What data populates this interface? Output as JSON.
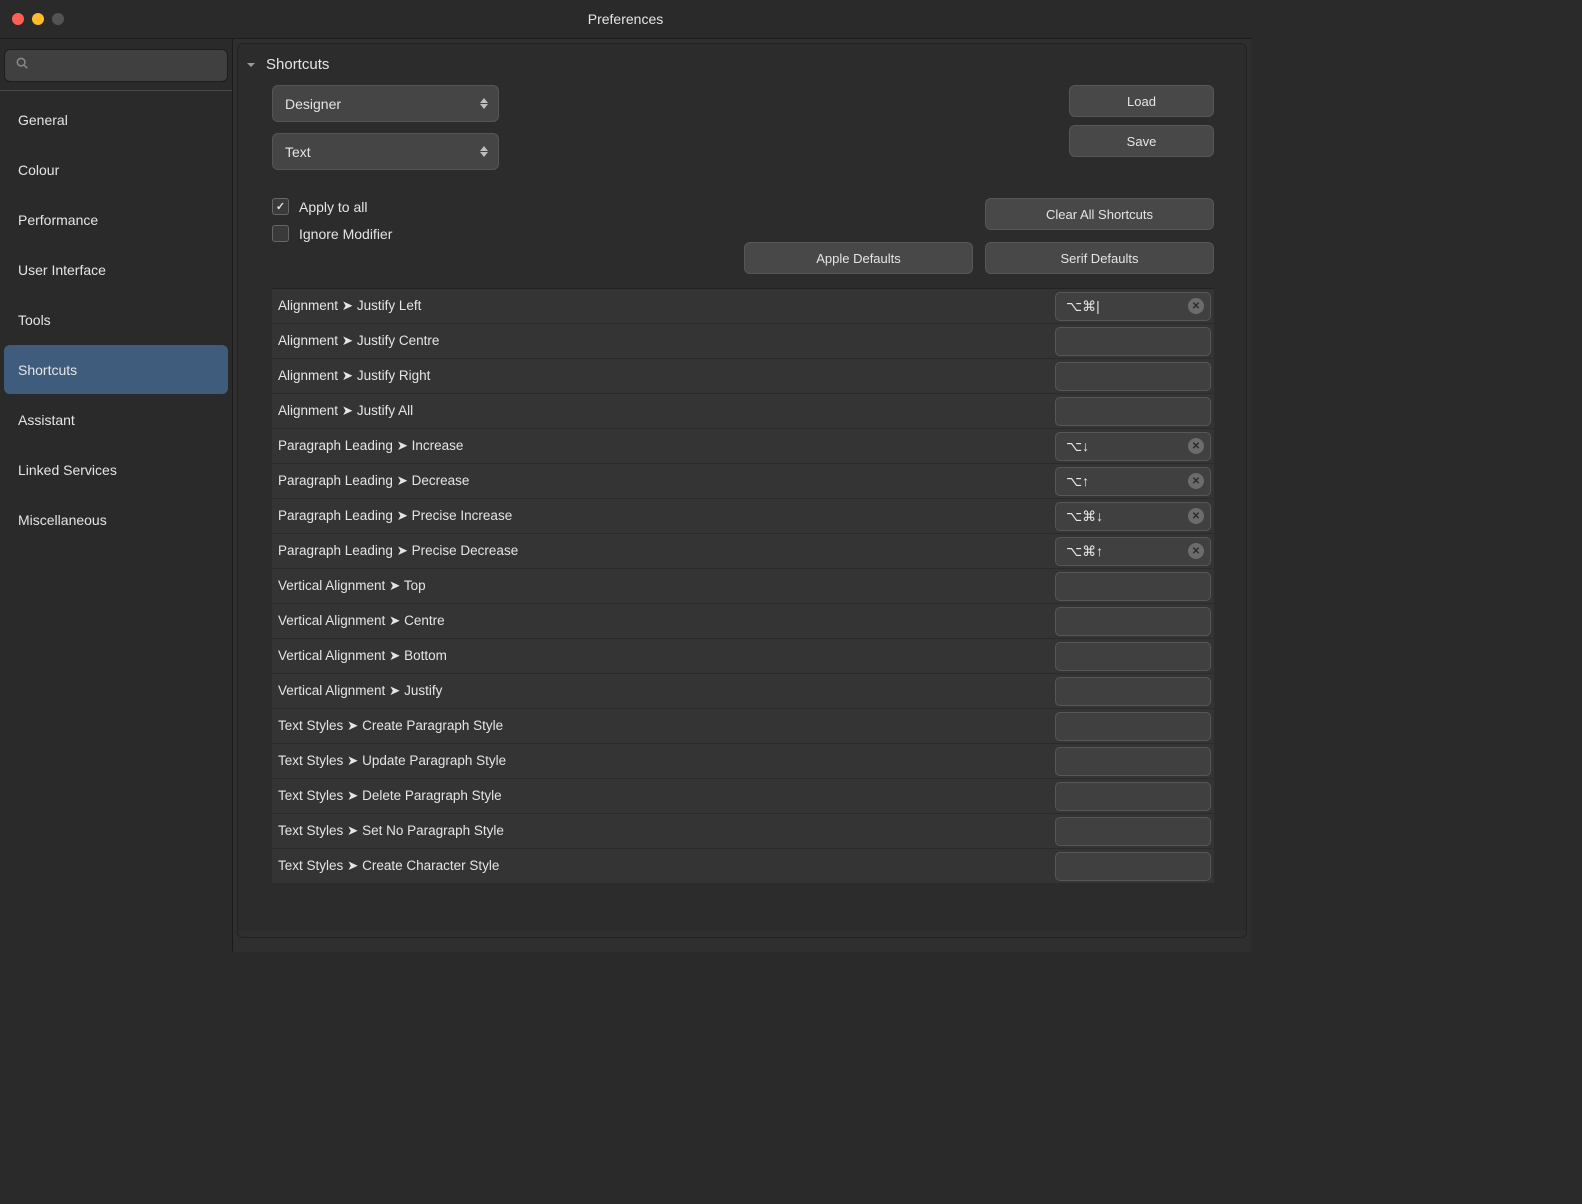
{
  "window": {
    "title": "Preferences"
  },
  "sidebar": {
    "search_placeholder": "",
    "items": [
      {
        "label": "General",
        "selected": false
      },
      {
        "label": "Colour",
        "selected": false
      },
      {
        "label": "Performance",
        "selected": false
      },
      {
        "label": "User Interface",
        "selected": false
      },
      {
        "label": "Tools",
        "selected": false
      },
      {
        "label": "Shortcuts",
        "selected": true
      },
      {
        "label": "Assistant",
        "selected": false
      },
      {
        "label": "Linked Services",
        "selected": false
      },
      {
        "label": "Miscellaneous",
        "selected": false
      }
    ]
  },
  "panel": {
    "title": "Shortcuts",
    "primary_select": "Designer",
    "secondary_select": "Text",
    "load_label": "Load",
    "save_label": "Save",
    "apply_all": {
      "label": "Apply to all",
      "checked": true
    },
    "ignore_modifier": {
      "label": "Ignore Modifier",
      "checked": false
    },
    "clear_all_label": "Clear All Shortcuts",
    "apple_defaults_label": "Apple Defaults",
    "serif_defaults_label": "Serif Defaults"
  },
  "shortcuts": [
    {
      "label": "Alignment  ➤  Justify Left",
      "value": "⌥⌘|",
      "has_clear": true
    },
    {
      "label": "Alignment  ➤  Justify Centre",
      "value": "",
      "has_clear": false
    },
    {
      "label": "Alignment  ➤  Justify Right",
      "value": "",
      "has_clear": false
    },
    {
      "label": "Alignment  ➤  Justify All",
      "value": "",
      "has_clear": false
    },
    {
      "label": "Paragraph Leading  ➤  Increase",
      "value": "⌥↓",
      "has_clear": true
    },
    {
      "label": "Paragraph Leading  ➤  Decrease",
      "value": "⌥↑",
      "has_clear": true
    },
    {
      "label": "Paragraph Leading  ➤  Precise Increase",
      "value": "⌥⌘↓",
      "has_clear": true
    },
    {
      "label": "Paragraph Leading  ➤  Precise Decrease",
      "value": "⌥⌘↑",
      "has_clear": true
    },
    {
      "label": "Vertical Alignment  ➤  Top",
      "value": "",
      "has_clear": false
    },
    {
      "label": "Vertical Alignment  ➤  Centre",
      "value": "",
      "has_clear": false
    },
    {
      "label": "Vertical Alignment  ➤  Bottom",
      "value": "",
      "has_clear": false
    },
    {
      "label": "Vertical Alignment  ➤  Justify",
      "value": "",
      "has_clear": false
    },
    {
      "label": "Text Styles  ➤  Create Paragraph Style",
      "value": "",
      "has_clear": false
    },
    {
      "label": "Text Styles  ➤  Update Paragraph Style",
      "value": "",
      "has_clear": false
    },
    {
      "label": "Text Styles  ➤  Delete Paragraph Style",
      "value": "",
      "has_clear": false
    },
    {
      "label": "Text Styles  ➤  Set No Paragraph Style",
      "value": "",
      "has_clear": false
    },
    {
      "label": "Text Styles  ➤  Create Character Style",
      "value": "",
      "has_clear": false
    }
  ]
}
